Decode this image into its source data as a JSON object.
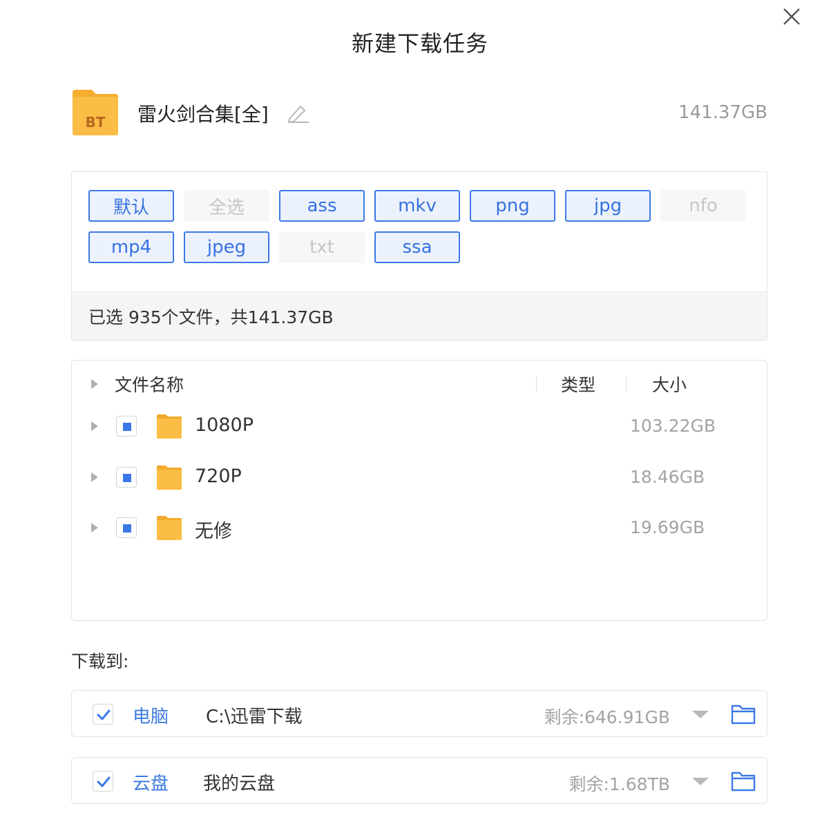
{
  "dialog": {
    "title": "新建下载任务"
  },
  "torrent": {
    "badge": "BT",
    "name": "雷火剑合集[全]",
    "size": "141.37GB"
  },
  "filter": {
    "tags": [
      {
        "label": "默认",
        "active": true
      },
      {
        "label": "全选",
        "active": false
      },
      {
        "label": "ass",
        "active": true
      },
      {
        "label": "mkv",
        "active": true
      },
      {
        "label": "png",
        "active": true
      },
      {
        "label": "jpg",
        "active": true
      },
      {
        "label": "nfo",
        "active": false
      },
      {
        "label": "mp4",
        "active": true
      },
      {
        "label": "jpeg",
        "active": true
      },
      {
        "label": "txt",
        "active": false
      },
      {
        "label": "ssa",
        "active": true
      }
    ],
    "summary": "已选 935个文件，共141.37GB"
  },
  "files": {
    "columns": {
      "name": "文件名称",
      "type": "类型",
      "size": "大小"
    },
    "rows": [
      {
        "name": "1080P",
        "size": "103.22GB",
        "checked": "partial"
      },
      {
        "name": "720P",
        "size": "18.46GB",
        "checked": "partial"
      },
      {
        "name": "无修",
        "size": "19.69GB",
        "checked": "partial"
      }
    ]
  },
  "download": {
    "label": "下载到:",
    "destinations": [
      {
        "kind": "电脑",
        "path": "C:\\迅雷下载",
        "remaining": "剩余:646.91GB",
        "checked": true
      },
      {
        "kind": "云盘",
        "path": "我的云盘",
        "remaining": "剩余:1.68TB",
        "checked": true
      }
    ]
  },
  "colors": {
    "accent": "#3b78e7",
    "folder": "#f9b83d",
    "muted": "#a3a3a3"
  }
}
